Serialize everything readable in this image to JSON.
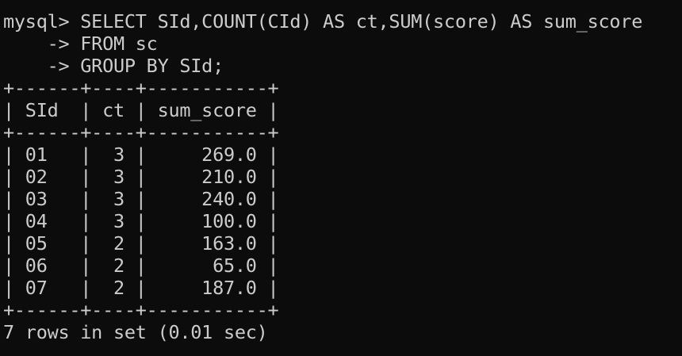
{
  "terminal": {
    "lines": [
      "mysql> SELECT SId,COUNT(CId) AS ct,SUM(score) AS sum_score",
      "    -> FROM sc",
      "    -> GROUP BY SId;",
      "+------+----+-----------+",
      "| SId  | ct | sum_score |",
      "+------+----+-----------+",
      "| 01   |  3 |     269.0 |",
      "| 02   |  3 |     210.0 |",
      "| 03   |  3 |     240.0 |",
      "| 04   |  3 |     100.0 |",
      "| 05   |  2 |     163.0 |",
      "| 06   |  2 |      65.0 |",
      "| 07   |  2 |     187.0 |",
      "+------+----+-----------+",
      "7 rows in set (0.01 sec)"
    ]
  },
  "colors": {
    "background": "#0c0c0c",
    "foreground": "#cccccc"
  }
}
